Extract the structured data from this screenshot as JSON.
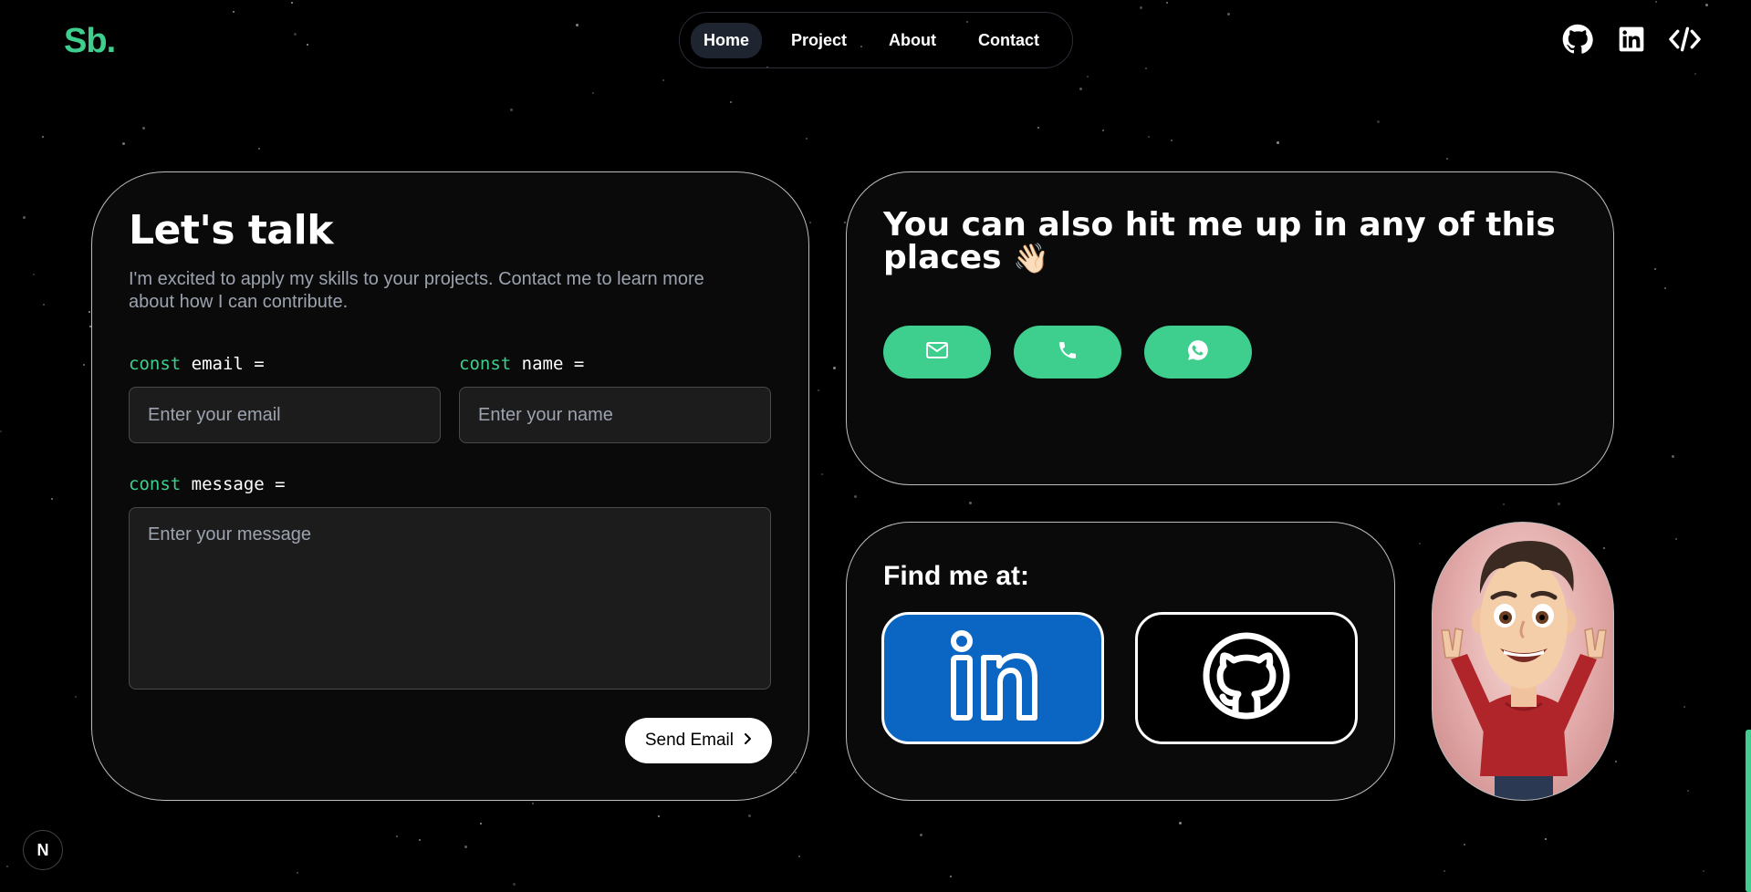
{
  "brand": {
    "logo": "Sb",
    "logo_dot": "."
  },
  "nav": {
    "items": [
      {
        "label": "Home",
        "active": true
      },
      {
        "label": "Project",
        "active": false
      },
      {
        "label": "About",
        "active": false
      },
      {
        "label": "Contact",
        "active": false
      }
    ]
  },
  "header_icons": [
    "github-icon",
    "linkedin-icon",
    "code-icon"
  ],
  "contact": {
    "title": "Let's talk",
    "description": "I'm excited to apply my skills to your projects. Contact me to learn more about how I can contribute.",
    "email_keyword": "const",
    "email_label": " email =",
    "email_placeholder": "Enter your email",
    "name_keyword": "const",
    "name_label": " name =",
    "name_placeholder": "Enter your name",
    "message_keyword": "const",
    "message_label": " message =",
    "message_placeholder": "Enter your message",
    "send_label": "Send Email",
    "send_icon": "chevron-right-icon"
  },
  "hit_me_up": {
    "title": "You can also hit me up in any of this places",
    "emoji": "👋🏻",
    "buttons": [
      "mail-icon",
      "phone-icon",
      "whatsapp-icon"
    ]
  },
  "find_me": {
    "title": "Find me at:",
    "tiles": [
      "linkedin-icon",
      "github-icon"
    ]
  },
  "footer": {
    "badge": "N"
  },
  "colors": {
    "accent": "#3ecf8e",
    "linkedin": "#0a66c2",
    "background": "#000000"
  }
}
